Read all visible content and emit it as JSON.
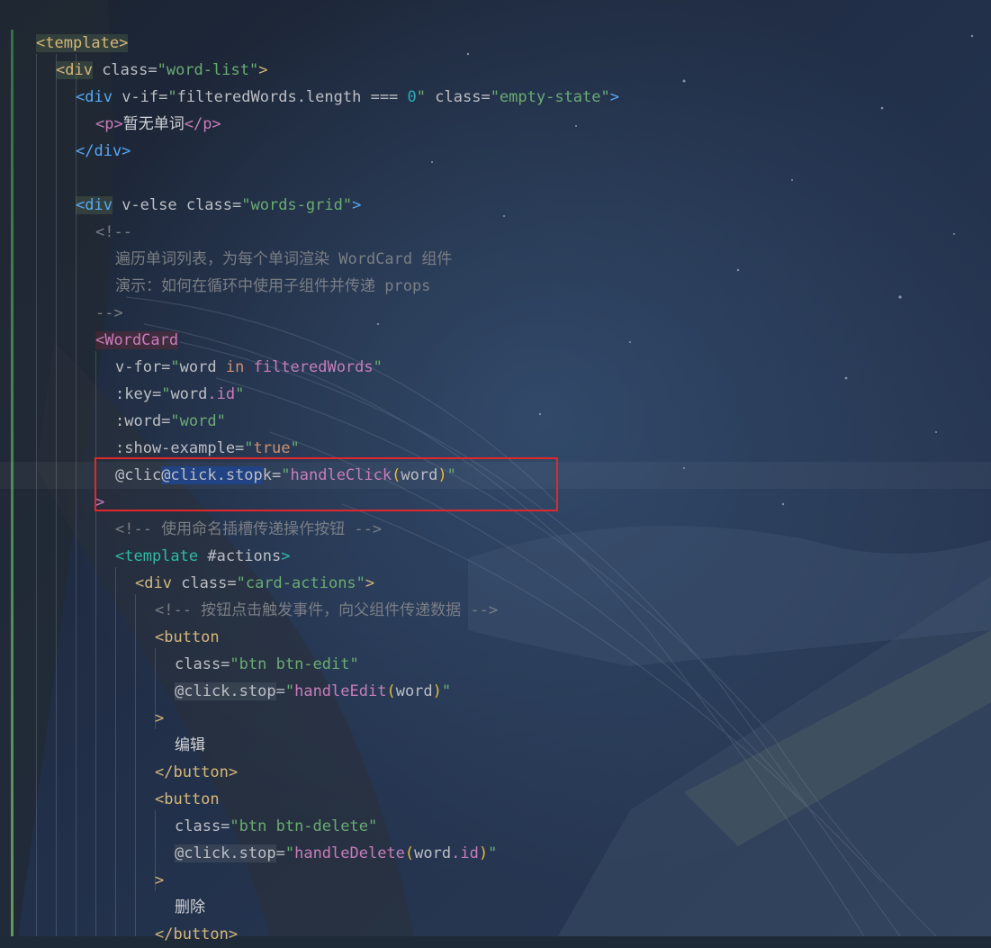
{
  "code": {
    "l1": {
      "tag": "<template>"
    },
    "l2": {
      "open": "<div",
      "attr": " class=",
      "value": "\"word-list\"",
      "close": ">"
    },
    "l3": {
      "open": "<div",
      "attr": " v-if=",
      "q1": "\"",
      "expr_a": "filteredWords",
      "expr_b": ".length",
      "op": " === ",
      "num": "0",
      "q2": "\"",
      "attr2": " class=",
      "value2": "\"empty-state\"",
      "close": ">"
    },
    "l4": {
      "open": "<p>",
      "text": "暂无单词",
      "close": "</p>"
    },
    "l5": {
      "tag": "</div>"
    },
    "l6": {
      "open": "<div",
      "attr": " v-else class=",
      "value": "\"words-grid\"",
      "close": ">"
    },
    "l7": {
      "text": "<!--"
    },
    "l8": {
      "text": "遍历单词列表，为每个单词渲染 WordCard 组件"
    },
    "l9": {
      "text": "演示：如何在循环中使用子组件并传递 props"
    },
    "l10": {
      "text": "-->"
    },
    "l11": {
      "tag": "<WordCard"
    },
    "l12": {
      "attr": "v-for=",
      "q1": "\"",
      "var": "word ",
      "kw": "in",
      "expr": " filteredWords",
      "q2": "\""
    },
    "l13": {
      "attr": ":key=",
      "q1": "\"",
      "var": "word",
      "prop": ".id",
      "q2": "\""
    },
    "l14": {
      "attr": ":word=",
      "value": "\"word\""
    },
    "l15": {
      "attr": ":show-example=",
      "q1": "\"",
      "kw": "true",
      "q2": "\""
    },
    "l16": {
      "attr_a": "@clic",
      "sel": "@click.stop",
      "attr_b": "k=",
      "q1": "\"",
      "fn": "handleClick",
      "p1": "(",
      "arg": "word",
      "p2": ")",
      "q2": "\""
    },
    "l17": {
      "tag": ">"
    },
    "l18": {
      "text": "<!-- 使用命名插槽传递操作按钮 -->"
    },
    "l19": {
      "open": "<template",
      "attr": " #actions",
      "close": ">"
    },
    "l20": {
      "open": "<div",
      "attr": " class=",
      "value": "\"card-actions\"",
      "close": ">"
    },
    "l21": {
      "text": "<!-- 按钮点击触发事件，向父组件传递数据 -->"
    },
    "l22": {
      "tag": "<button"
    },
    "l23": {
      "attr": "class=",
      "value": "\"btn btn-edit\""
    },
    "l24": {
      "attr": "@click.stop",
      "eq": "=",
      "q1": "\"",
      "fn": "handleEdit",
      "p1": "(",
      "arg": "word",
      "p2": ")",
      "q2": "\""
    },
    "l25": {
      "tag": ">"
    },
    "l26": {
      "text": "编辑"
    },
    "l27": {
      "tag": "</button>"
    },
    "l28": {
      "tag": "<button"
    },
    "l29": {
      "attr": "class=",
      "value": "\"btn btn-delete\""
    },
    "l30": {
      "attr": "@click.stop",
      "eq": "=",
      "q1": "\"",
      "fn": "handleDelete",
      "p1": "(",
      "arg": "word",
      "prop": ".id",
      "p2": ")",
      "q2": "\""
    },
    "l31": {
      "tag": ">"
    },
    "l32": {
      "text": "删除"
    },
    "l33": {
      "tag": "</button>"
    }
  },
  "colors": {
    "background": "#1f2a38",
    "tag_yellow": "#d5b778",
    "tag_blue": "#56a8f5",
    "string_green": "#6aab73",
    "comment_gray": "#7a7e85",
    "selection": "#214283",
    "annotation_box": "#e0282c"
  }
}
